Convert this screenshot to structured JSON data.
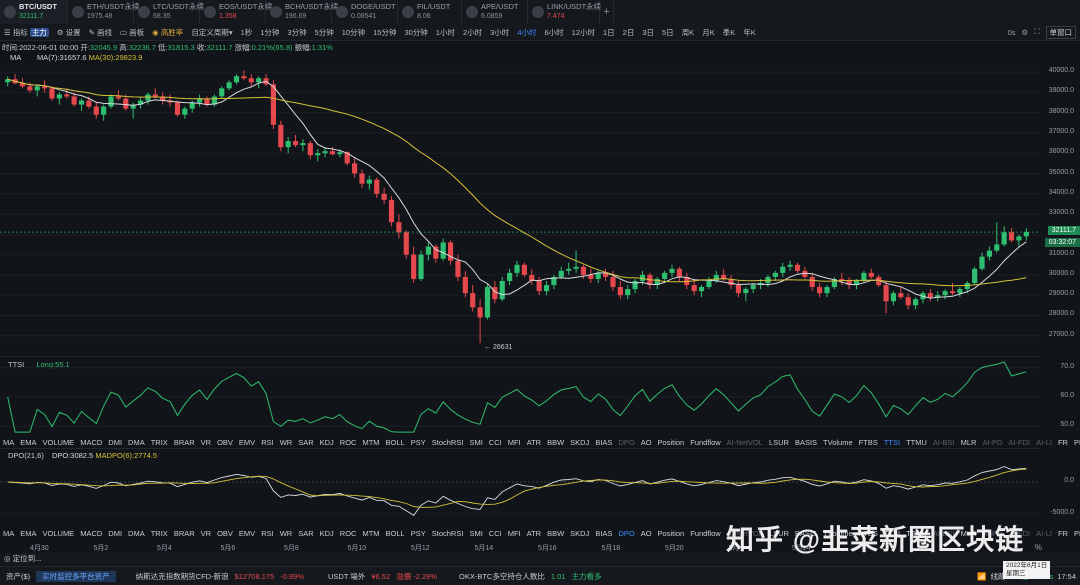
{
  "tabs": [
    {
      "symbol": "BTC/USDT",
      "price": "32111.7",
      "trend": "up",
      "active": true
    },
    {
      "symbol": "ETH/USDT永续",
      "price": "1975.48",
      "trend": "neutral"
    },
    {
      "symbol": "LTC/USDT永续",
      "price": "68.35",
      "trend": "neutral"
    },
    {
      "symbol": "EOS/USDT永续",
      "price": "1.358",
      "trend": "down"
    },
    {
      "symbol": "BCH/USDT永续",
      "price": "196.69",
      "trend": "neutral"
    },
    {
      "symbol": "DOGE/USDT",
      "price": "0.08541",
      "trend": "neutral"
    },
    {
      "symbol": "FIL/USDT",
      "price": "8.06",
      "trend": "neutral"
    },
    {
      "symbol": "APE/USDT",
      "price": "6.0859",
      "trend": "neutral"
    },
    {
      "symbol": "LINK/USDT永续",
      "price": "7.474",
      "trend": "down"
    }
  ],
  "tab_add": "+",
  "toolbar": {
    "items": [
      {
        "label": "指标",
        "badge": "主力"
      },
      {
        "label": "设置"
      },
      {
        "label": "画线"
      },
      {
        "label": "画板"
      },
      {
        "label": "高胜率",
        "gold": true
      },
      {
        "label": "自定义周期",
        "arrow": "▾"
      },
      {
        "label": "1秒"
      },
      {
        "label": "1分钟"
      },
      {
        "label": "3分钟"
      },
      {
        "label": "5分钟"
      },
      {
        "label": "10分钟"
      },
      {
        "label": "15分钟"
      },
      {
        "label": "30分钟"
      },
      {
        "label": "1小时"
      },
      {
        "label": "2小时"
      },
      {
        "label": "3小时"
      },
      {
        "label": "4小时",
        "active": true
      },
      {
        "label": "6小时"
      },
      {
        "label": "12小时"
      },
      {
        "label": "1日"
      },
      {
        "label": "2日"
      },
      {
        "label": "3日"
      },
      {
        "label": "5日"
      },
      {
        "label": "周K"
      },
      {
        "label": "月K"
      },
      {
        "label": "季K"
      },
      {
        "label": "年K"
      }
    ],
    "right": {
      "timer": "0s",
      "window": "单窗口"
    }
  },
  "info": {
    "time_label": "时间:",
    "time": "2022-06-01 00:00",
    "open_label": "开:",
    "open": "32045.9",
    "high_label": "高:",
    "high": "32236.7",
    "low_label": "低:",
    "low": "31815.3",
    "close_label": "收:",
    "close": "32111.7",
    "change_label": "涨幅:",
    "change": "0.21%(65.8)",
    "amp_label": "振幅:",
    "amp": "1.31%"
  },
  "ma": {
    "ma7": "MA(7):31657.6",
    "ma30": "MA(30):29823.9",
    "ma_label": "MA"
  },
  "price_axis": [
    "40000.0",
    "39000.0",
    "38000.0",
    "37000.0",
    "36000.0",
    "35000.0",
    "34000.0",
    "33000.0",
    "32000.0",
    "31000.0",
    "30000.0",
    "29000.0",
    "28000.0",
    "27000.0"
  ],
  "current_price": "32111.7",
  "countdown": "03:32:07",
  "low_marker": "26631",
  "ttsi": {
    "label": "TTSI",
    "long": "Long:55.1",
    "axis": [
      "70.0",
      "60.0",
      "50.0"
    ]
  },
  "indicators": [
    {
      "n": "MA"
    },
    {
      "n": "EMA"
    },
    {
      "n": "VOLUME"
    },
    {
      "n": "MACD"
    },
    {
      "n": "DMI"
    },
    {
      "n": "DMA"
    },
    {
      "n": "TRIX"
    },
    {
      "n": "BRAR"
    },
    {
      "n": "VR"
    },
    {
      "n": "OBV"
    },
    {
      "n": "EMV"
    },
    {
      "n": "RSI"
    },
    {
      "n": "WR"
    },
    {
      "n": "SAR"
    },
    {
      "n": "KDJ"
    },
    {
      "n": "ROC"
    },
    {
      "n": "MTM"
    },
    {
      "n": "BOLL"
    },
    {
      "n": "PSY"
    },
    {
      "n": "StochRSI"
    },
    {
      "n": "SMI"
    },
    {
      "n": "CCI"
    },
    {
      "n": "MFI"
    },
    {
      "n": "ATR"
    },
    {
      "n": "BBW"
    },
    {
      "n": "SKDJ"
    },
    {
      "n": "BIAS"
    },
    {
      "n": "DPO",
      "dim": true
    },
    {
      "n": "AO"
    },
    {
      "n": "Position"
    },
    {
      "n": "Fundflow"
    },
    {
      "n": "AI-NetVOL",
      "dim": true
    },
    {
      "n": "LSUR"
    },
    {
      "n": "BASIS"
    },
    {
      "n": "TVolume"
    },
    {
      "n": "FTBS"
    },
    {
      "n": "TTSI",
      "sel": true
    },
    {
      "n": "TTMU"
    },
    {
      "n": "AI-BSI",
      "dim": true
    },
    {
      "n": "MLR"
    },
    {
      "n": "AI-PD",
      "dim": true
    },
    {
      "n": "AI-FDI",
      "dim": true
    },
    {
      "n": "AI-LI",
      "dim": true
    },
    {
      "n": "FR"
    },
    {
      "n": "PFR"
    },
    {
      "n": "AI-BST",
      "dim": true
    }
  ],
  "dpo": {
    "label": "DPO(21,6)",
    "dpo": "DPO:3082.5",
    "madpo": "MADPO(6):2774.5",
    "axis": [
      "0.0",
      "-5000.0"
    ]
  },
  "indicators2": [
    {
      "n": "MA"
    },
    {
      "n": "EMA"
    },
    {
      "n": "VOLUME"
    },
    {
      "n": "MACD"
    },
    {
      "n": "DMI"
    },
    {
      "n": "DMA"
    },
    {
      "n": "TRIX"
    },
    {
      "n": "BRAR"
    },
    {
      "n": "VR"
    },
    {
      "n": "OBV"
    },
    {
      "n": "EMV"
    },
    {
      "n": "RSI"
    },
    {
      "n": "WR"
    },
    {
      "n": "SAR"
    },
    {
      "n": "KDJ"
    },
    {
      "n": "ROC"
    },
    {
      "n": "MTM"
    },
    {
      "n": "BOLL"
    },
    {
      "n": "PSY"
    },
    {
      "n": "StochRSI"
    },
    {
      "n": "SMI"
    },
    {
      "n": "CCI"
    },
    {
      "n": "MFI"
    },
    {
      "n": "ATR"
    },
    {
      "n": "BBW"
    },
    {
      "n": "SKDJ"
    },
    {
      "n": "BIAS"
    },
    {
      "n": "DPO",
      "sel": true
    },
    {
      "n": "AO"
    },
    {
      "n": "Position"
    },
    {
      "n": "Fundflow"
    },
    {
      "n": "AI-NetVOL",
      "dim": true
    },
    {
      "n": "LSUR"
    },
    {
      "n": "BASIS"
    },
    {
      "n": "TVolume"
    },
    {
      "n": "FTBS"
    },
    {
      "n": "TTSI"
    },
    {
      "n": "TTMU"
    },
    {
      "n": "AI-BSI",
      "dim": true
    },
    {
      "n": "MLR"
    },
    {
      "n": "AI-PD",
      "dim": true
    },
    {
      "n": "AI-FDI",
      "dim": true
    },
    {
      "n": "AI-LI",
      "dim": true
    },
    {
      "n": "FR"
    },
    {
      "n": "PFR"
    },
    {
      "n": "AI-BST",
      "dim": true
    }
  ],
  "x_axis": [
    "4月30",
    "5月2",
    "5月4",
    "5月6",
    "5月8",
    "5月10",
    "5月12",
    "5月14",
    "5月16",
    "5月18",
    "5月20",
    "5月",
    "5月24"
  ],
  "percent_sign": "%",
  "locate": "定位到...",
  "status": {
    "assets": "资产($)",
    "monitor": "实时监控多平台资产",
    "nasdaq": "纳斯达克指数期货CFD-新浪",
    "nasdaq_val": "$12708.175",
    "nasdaq_chg": "-0.89%",
    "usdt": "USDT 場外",
    "usdt_val": "¥6.52",
    "usdt_prem": "溢價 -2.28%",
    "okx": "OKX-BTC多空持仓人数比",
    "okx_val": "1.01",
    "okx_note": "主力看多",
    "line": "线路1：",
    "latency": "延 181ms",
    "clock": "17:54"
  },
  "datebox": {
    "date": "2022年6月1日",
    "weekday": "星期三"
  },
  "watermark": "知乎 @韭菜新圈区块链",
  "colors": {
    "up": "#2fbf71",
    "down": "#e5484d",
    "ma7": "#d8dbe0",
    "ma30": "#d6c13a",
    "ttsi": "#2fbf71",
    "accent": "#3d8bfd"
  },
  "chart_data": {
    "type": "candlestick",
    "interval": "4小时",
    "y_range": [
      26000,
      40500
    ],
    "low_marker": 26631,
    "last_close": 32111.7,
    "candles": [
      [
        39500,
        39800,
        39300,
        39650
      ],
      [
        39650,
        39900,
        39400,
        39450
      ],
      [
        39450,
        39700,
        39200,
        39300
      ],
      [
        39300,
        39500,
        39000,
        39100
      ],
      [
        39100,
        39400,
        38800,
        39300
      ],
      [
        39300,
        39600,
        39000,
        39200
      ],
      [
        39200,
        39300,
        38600,
        38700
      ],
      [
        38700,
        39000,
        38400,
        38900
      ],
      [
        38900,
        39200,
        38700,
        38800
      ],
      [
        38800,
        39000,
        38300,
        38400
      ],
      [
        38400,
        38700,
        38100,
        38600
      ],
      [
        38600,
        38800,
        38200,
        38300
      ],
      [
        38300,
        38500,
        37700,
        37900
      ],
      [
        37900,
        38400,
        37600,
        38300
      ],
      [
        38300,
        38900,
        38200,
        38800
      ],
      [
        38800,
        39100,
        38600,
        38700
      ],
      [
        38700,
        38900,
        38100,
        38200
      ],
      [
        38200,
        38500,
        37700,
        38400
      ],
      [
        38400,
        38800,
        38200,
        38600
      ],
      [
        38600,
        39000,
        38400,
        38900
      ],
      [
        38900,
        39200,
        38700,
        38800
      ],
      [
        38800,
        39000,
        38400,
        38600
      ],
      [
        38600,
        38900,
        38300,
        38500
      ],
      [
        38500,
        38600,
        37800,
        37900
      ],
      [
        37900,
        38300,
        37700,
        38200
      ],
      [
        38200,
        38600,
        38000,
        38500
      ],
      [
        38500,
        38900,
        38300,
        38700
      ],
      [
        38700,
        38800,
        38300,
        38400
      ],
      [
        38400,
        38900,
        38300,
        38800
      ],
      [
        38800,
        39300,
        38700,
        39200
      ],
      [
        39200,
        39600,
        39100,
        39500
      ],
      [
        39500,
        39900,
        39400,
        39800
      ],
      [
        39800,
        40100,
        39600,
        39700
      ],
      [
        39700,
        39900,
        39300,
        39500
      ],
      [
        39500,
        39800,
        39200,
        39700
      ],
      [
        39700,
        39900,
        39300,
        39400
      ],
      [
        39400,
        39600,
        37200,
        37400
      ],
      [
        37400,
        37600,
        36100,
        36300
      ],
      [
        36300,
        36800,
        36000,
        36600
      ],
      [
        36600,
        36900,
        36300,
        36400
      ],
      [
        36400,
        36700,
        36100,
        36500
      ],
      [
        36500,
        36600,
        35700,
        35900
      ],
      [
        35900,
        36200,
        35600,
        36000
      ],
      [
        36000,
        36300,
        35800,
        36100
      ],
      [
        36100,
        36300,
        35900,
        35950
      ],
      [
        35950,
        36200,
        35800,
        36050
      ],
      [
        36050,
        36100,
        35400,
        35500
      ],
      [
        35500,
        35800,
        34800,
        35000
      ],
      [
        35000,
        35200,
        34300,
        34500
      ],
      [
        34500,
        34900,
        34200,
        34700
      ],
      [
        34700,
        34800,
        33800,
        34000
      ],
      [
        34000,
        34300,
        33500,
        33700
      ],
      [
        33700,
        33900,
        32400,
        32600
      ],
      [
        32600,
        33000,
        31800,
        32100
      ],
      [
        32100,
        32200,
        30800,
        31000
      ],
      [
        31000,
        31400,
        29600,
        29800
      ],
      [
        29800,
        31200,
        29700,
        31000
      ],
      [
        31000,
        31600,
        30700,
        31400
      ],
      [
        31400,
        31500,
        30600,
        30800
      ],
      [
        30800,
        31800,
        30700,
        31600
      ],
      [
        31600,
        31700,
        30500,
        30700
      ],
      [
        30700,
        31000,
        29700,
        29900
      ],
      [
        29900,
        30200,
        28900,
        29100
      ],
      [
        29100,
        29500,
        28200,
        28400
      ],
      [
        28400,
        28800,
        26631,
        27900
      ],
      [
        27900,
        29600,
        27800,
        29400
      ],
      [
        29400,
        29700,
        28600,
        28800
      ],
      [
        28800,
        29900,
        28700,
        29700
      ],
      [
        29700,
        30300,
        29500,
        30100
      ],
      [
        30100,
        30700,
        29900,
        30500
      ],
      [
        30500,
        30600,
        29900,
        30000
      ],
      [
        30000,
        30300,
        29500,
        29700
      ],
      [
        29700,
        29900,
        29000,
        29200
      ],
      [
        29200,
        29700,
        29000,
        29500
      ],
      [
        29500,
        30000,
        29300,
        29900
      ],
      [
        29900,
        30400,
        29800,
        30200
      ],
      [
        30200,
        30600,
        30000,
        30300
      ],
      [
        30300,
        31200,
        30100,
        30400
      ],
      [
        30400,
        30500,
        29800,
        30000
      ],
      [
        30000,
        30300,
        29600,
        29800
      ],
      [
        29800,
        30200,
        29600,
        30100
      ],
      [
        30100,
        30300,
        29700,
        29900
      ],
      [
        29900,
        30200,
        29200,
        29400
      ],
      [
        29400,
        29700,
        28800,
        29000
      ],
      [
        29000,
        29500,
        28800,
        29300
      ],
      [
        29300,
        29800,
        29100,
        29700
      ],
      [
        29700,
        30200,
        29500,
        30000
      ],
      [
        30000,
        30100,
        29300,
        29500
      ],
      [
        29500,
        29900,
        29300,
        29800
      ],
      [
        29800,
        30200,
        29600,
        30100
      ],
      [
        30100,
        30500,
        29900,
        30300
      ],
      [
        30300,
        30400,
        29700,
        29900
      ],
      [
        29900,
        30100,
        29300,
        29500
      ],
      [
        29500,
        29800,
        29000,
        29200
      ],
      [
        29200,
        29500,
        28900,
        29400
      ],
      [
        29400,
        29900,
        29300,
        29700
      ],
      [
        29700,
        30200,
        29600,
        30000
      ],
      [
        30000,
        30300,
        29700,
        29800
      ],
      [
        29800,
        30000,
        29300,
        29500
      ],
      [
        29500,
        29700,
        28900,
        29100
      ],
      [
        29100,
        29400,
        28700,
        29300
      ],
      [
        29300,
        29600,
        29100,
        29500
      ],
      [
        29500,
        29800,
        29300,
        29600
      ],
      [
        29600,
        30000,
        29400,
        29900
      ],
      [
        29900,
        30200,
        29700,
        30100
      ],
      [
        30100,
        30600,
        29900,
        30400
      ],
      [
        30400,
        30700,
        30200,
        30500
      ],
      [
        30500,
        30600,
        30100,
        30200
      ],
      [
        30200,
        30400,
        29800,
        29900
      ],
      [
        29900,
        30100,
        29200,
        29400
      ],
      [
        29400,
        29600,
        28900,
        29100
      ],
      [
        29100,
        29500,
        28900,
        29400
      ],
      [
        29400,
        29900,
        29300,
        29800
      ],
      [
        29800,
        30100,
        29500,
        29700
      ],
      [
        29700,
        29900,
        29300,
        29500
      ],
      [
        29500,
        29800,
        29300,
        29700
      ],
      [
        29700,
        30200,
        29600,
        30100
      ],
      [
        30100,
        30300,
        29800,
        29900
      ],
      [
        29900,
        30000,
        29400,
        29500
      ],
      [
        29500,
        29700,
        28100,
        28700
      ],
      [
        28700,
        29200,
        28500,
        29100
      ],
      [
        29100,
        29400,
        28800,
        28900
      ],
      [
        28900,
        29100,
        28300,
        28500
      ],
      [
        28500,
        28900,
        28300,
        28800
      ],
      [
        28800,
        29200,
        28600,
        29100
      ],
      [
        29100,
        29300,
        28700,
        28900
      ],
      [
        28900,
        29200,
        28700,
        29000
      ],
      [
        29000,
        29300,
        28800,
        29200
      ],
      [
        29200,
        29600,
        29000,
        29100
      ],
      [
        29100,
        29400,
        28900,
        29300
      ],
      [
        29300,
        29700,
        29100,
        29600
      ],
      [
        29600,
        30400,
        29500,
        30300
      ],
      [
        30300,
        31100,
        30200,
        30900
      ],
      [
        30900,
        31400,
        30700,
        31200
      ],
      [
        31200,
        32600,
        31100,
        31500
      ],
      [
        31500,
        32400,
        31400,
        32100
      ],
      [
        32100,
        32300,
        31600,
        31700
      ],
      [
        31700,
        32000,
        31400,
        31900
      ],
      [
        31900,
        32300,
        31700,
        32111.7
      ]
    ]
  }
}
